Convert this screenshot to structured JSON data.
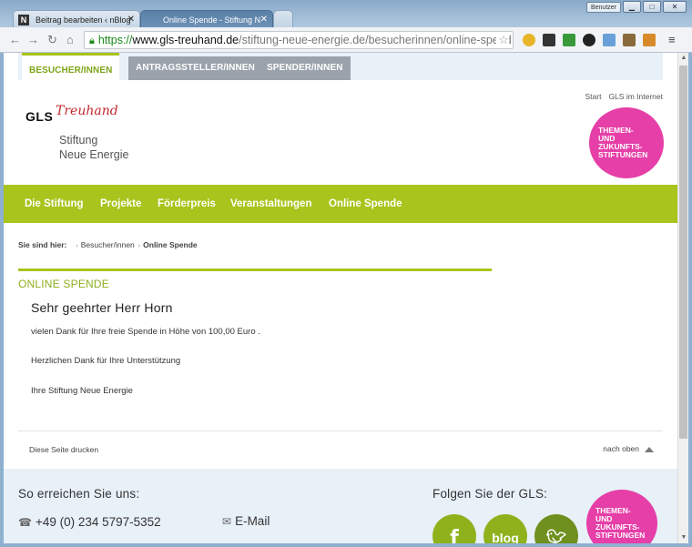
{
  "browser": {
    "tabs": [
      {
        "label": "Beitrag bearbeiten ‹ nBlog",
        "favicon": "N"
      },
      {
        "label": "Online Spende - Stiftung N"
      }
    ],
    "profile_label": "Benutzer",
    "window_controls": {
      "minimize": "▁",
      "maximize": "□",
      "close": "✕"
    },
    "url": {
      "scheme": "https://",
      "host": "www.gls-treuhand.de",
      "path": "/stiftung-neue-energie.de/besucherinnen/online-spend"
    },
    "icons": {
      "back": "back-arrow-icon",
      "forward": "forward-arrow-icon",
      "reload": "reload-icon",
      "home": "home-icon",
      "lock": "lock-icon",
      "star": "star-icon",
      "menu": "menu-icon"
    }
  },
  "audience_tabs": [
    "BESUCHER/INNEN",
    "ANTRAGSSTELLER/INNEN",
    "SPENDER/INNEN"
  ],
  "top_links": [
    "Start",
    "GLS im Internet"
  ],
  "logo": {
    "gls": "GLS",
    "treuhand": "Treuhand",
    "line1": "Stiftung",
    "line2": "Neue Energie"
  },
  "badge": {
    "lines": [
      "Themen-",
      "und",
      "Zukunfts-",
      "stiftungen"
    ]
  },
  "nav": [
    "Die Stiftung",
    "Projekte",
    "Förderpreis",
    "Veranstaltungen",
    "Online Spende"
  ],
  "breadcrumb": {
    "lead": "Sie sind hier:",
    "items": [
      "Besucher/innen",
      "Online Spende"
    ]
  },
  "content": {
    "section_title": "ONLINE SPENDE",
    "greeting": "Sehr geehrter Herr Horn",
    "paragraphs": [
      "vielen Dank für Ihre freie Spende in Höhe von 100,00 Euro .",
      "Herzlichen Dank für Ihre Unterstützung",
      "Ihre Stiftung Neue Energie"
    ],
    "print_label": "Diese Seite drucken",
    "top_label": "nach oben"
  },
  "footer": {
    "contact_heading": "So erreichen Sie uns:",
    "phone": "+49 (0) 234 5797-5352",
    "email_label": "E-Mail",
    "follow_heading": "Folgen Sie der GLS:",
    "social": {
      "facebook": "f",
      "blog": "blog"
    }
  },
  "colors": {
    "accent_green": "#a9c41d",
    "badge_pink": "#e63fa8",
    "treuhand_red": "#c2272d"
  }
}
